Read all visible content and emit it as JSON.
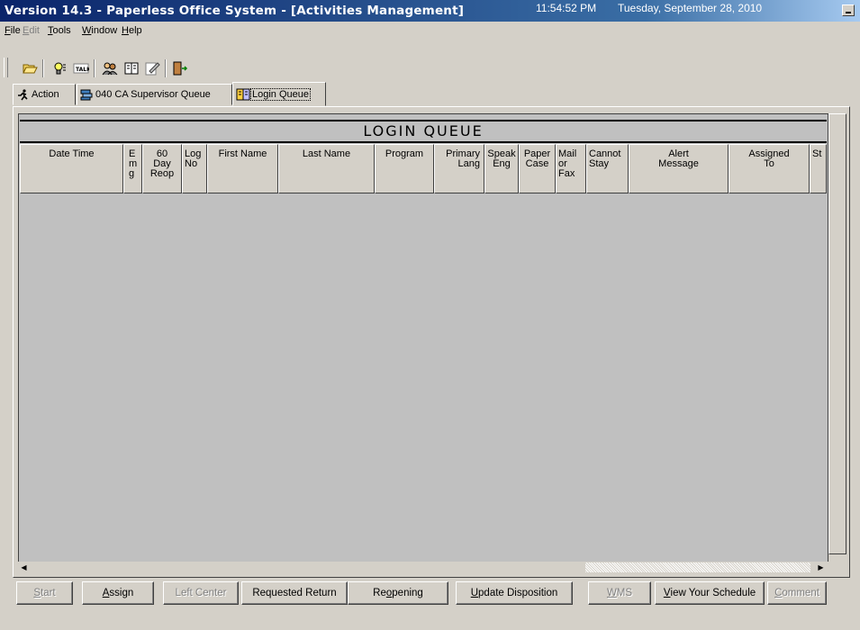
{
  "window": {
    "title": "Version 14.3 - Paperless Office System - [Activities Management]",
    "time": "11:54:52 PM",
    "date": "Tuesday, September 28, 2010"
  },
  "menu": [
    {
      "label": "File",
      "accel": "F",
      "rest": "ile",
      "disabled": false
    },
    {
      "label": "Edit",
      "accel": "E",
      "rest": "dit",
      "disabled": true
    },
    {
      "label": "Tools",
      "accel": "T",
      "rest": "ools",
      "disabled": false
    },
    {
      "label": "Window",
      "accel": "W",
      "rest": "indow",
      "disabled": false
    },
    {
      "label": "Help",
      "accel": "H",
      "rest": "elp",
      "disabled": false
    }
  ],
  "toolbar": {
    "icons": [
      "folder-open-icon",
      "lightbulb-icon",
      "talk-icon",
      "people-icon",
      "book-icon",
      "document-edit-icon",
      "exit-door-icon"
    ]
  },
  "tabs": [
    {
      "label": "Action",
      "icon": "running-man-icon"
    },
    {
      "label": "040 CA Supervisor Queue",
      "icon": "queue-icon"
    },
    {
      "label": "Login Queue",
      "icon": "login-queue-icon",
      "active": true
    }
  ],
  "queue": {
    "title": "LOGIN  QUEUE",
    "columns": [
      "Date Time",
      "E\nm\ng",
      "60\nDay\nReop",
      "Log\nNo",
      "First Name",
      "Last Name",
      "Program",
      "Primary\nLang",
      "Speak\nEng",
      "Paper\nCase",
      "Mail\nor\nFax",
      "Cannot\nStay",
      "Alert\nMessage",
      "Assigned\nTo",
      "St"
    ],
    "rows": []
  },
  "buttons": {
    "start": {
      "pre": "",
      "accel": "S",
      "post": "tart",
      "disabled": true
    },
    "assign": {
      "pre": "",
      "accel": "A",
      "post": "ssign",
      "disabled": false
    },
    "left_center": {
      "label": "Left Center",
      "disabled": true
    },
    "requested_return": {
      "label": "Requested Return",
      "disabled": false
    },
    "reopening": {
      "pre": "Re",
      "accel": "o",
      "post": "pening",
      "disabled": false
    },
    "update_disposition": {
      "pre": "",
      "accel": "U",
      "post": "pdate Disposition",
      "disabled": false
    },
    "wms": {
      "pre": "",
      "accel": "W",
      "post": "MS",
      "disabled": true
    },
    "view_schedule": {
      "pre": "",
      "accel": "V",
      "post": "iew Your Schedule",
      "disabled": false
    },
    "comment": {
      "pre": "",
      "accel": "C",
      "post": "omment",
      "disabled": true
    }
  }
}
